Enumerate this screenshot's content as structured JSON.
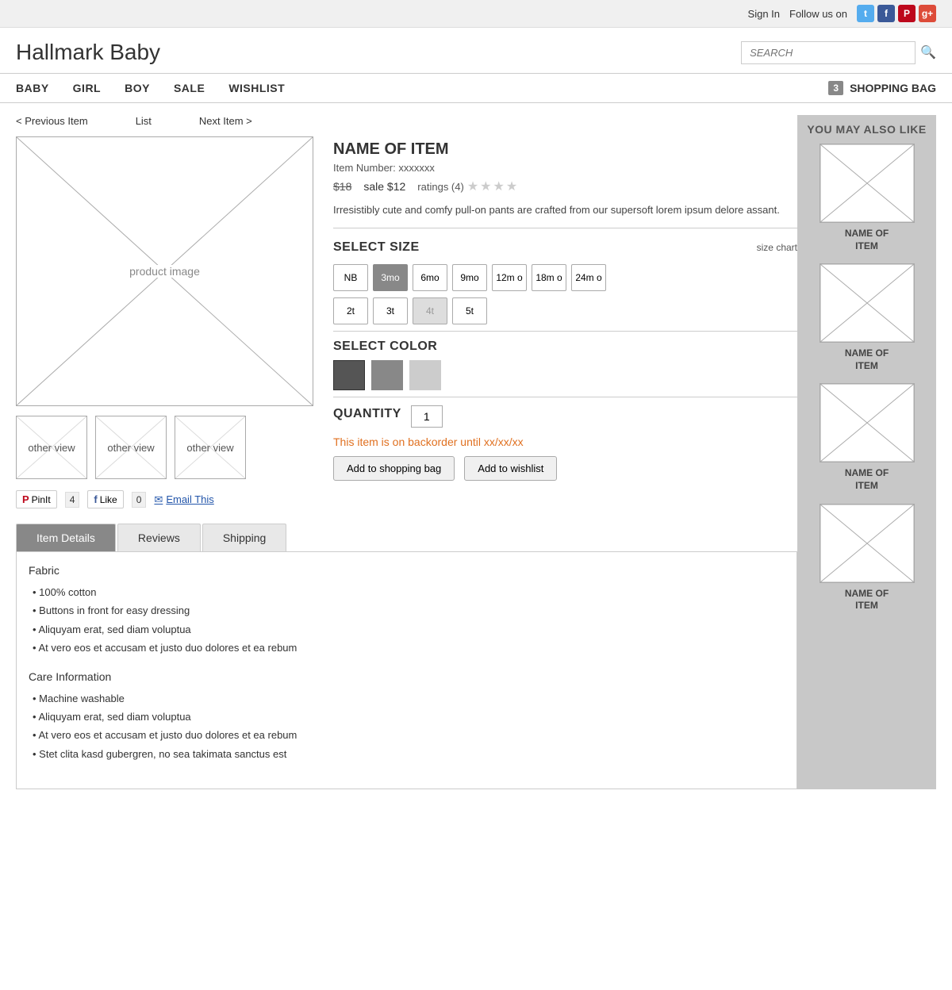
{
  "topbar": {
    "sign_in": "Sign In",
    "follow_us": "Follow us on"
  },
  "header": {
    "brand": "Hallmark Baby",
    "search_placeholder": "SEARCH"
  },
  "nav": {
    "items": [
      "BABY",
      "GIRL",
      "BOY",
      "SALE",
      "WISHLIST"
    ],
    "cart_count": "3",
    "cart_label": "SHOPPING BAG"
  },
  "item_nav": {
    "prev": "< Previous Item",
    "list": "List",
    "next": "Next Item >"
  },
  "product": {
    "image_label": "product image",
    "name": "NAME OF ITEM",
    "item_number": "Item Number: xxxxxxx",
    "price_original": "$18",
    "price_sale": "sale $12",
    "ratings_text": "ratings (4)",
    "description": "Irresistibly cute and comfy pull-on pants are crafted from our supersoft lorem ipsum delore assant.",
    "select_size_label": "SELECT SIZE",
    "size_chart": "size chart",
    "sizes": [
      "NB",
      "3mo",
      "6mo",
      "9mo",
      "12mo",
      "18mo",
      "24mo",
      "2t",
      "3t",
      "4t",
      "5t"
    ],
    "selected_size": "3mo",
    "disabled_size": "4t",
    "select_color_label": "SELECT COLOR",
    "colors": [
      "#555555",
      "#888888",
      "#cccccc"
    ],
    "quantity_label": "QUANTITY",
    "quantity_value": "1",
    "backorder_msg": "This item is on backorder until xx/xx/xx",
    "btn_add_cart": "Add to shopping bag",
    "btn_wishlist": "Add to wishlist",
    "other_views": [
      "other view",
      "other view",
      "other view"
    ],
    "pin_count": "4",
    "fb_count": "0",
    "fb_like": "Like",
    "pin_label": "PinIt",
    "email_label": "Email This"
  },
  "tabs": {
    "items": [
      "Item Details",
      "Reviews",
      "Shipping"
    ],
    "active": "Item Details"
  },
  "tab_content": {
    "fabric_title": "Fabric",
    "fabric_items": [
      "100% cotton",
      "Buttons in front for easy dressing",
      "Aliquyam erat, sed diam voluptua",
      "At vero eos et accusam et justo duo dolores et ea rebum"
    ],
    "care_title": "Care Information",
    "care_items": [
      "Machine washable",
      "Aliquyam erat, sed diam voluptua",
      "At vero eos et accusam et justo duo dolores et ea rebum",
      "Stet clita kasd gubergren, no sea takimata sanctus est"
    ]
  },
  "sidebar": {
    "title": "YOU MAY ALSO LIKE",
    "items": [
      {
        "name": "NAME OF\nITEM"
      },
      {
        "name": "NAME OF\nITEM"
      },
      {
        "name": "NAME OF\nITEM"
      },
      {
        "name": "NAME OF\nITEM"
      }
    ]
  }
}
